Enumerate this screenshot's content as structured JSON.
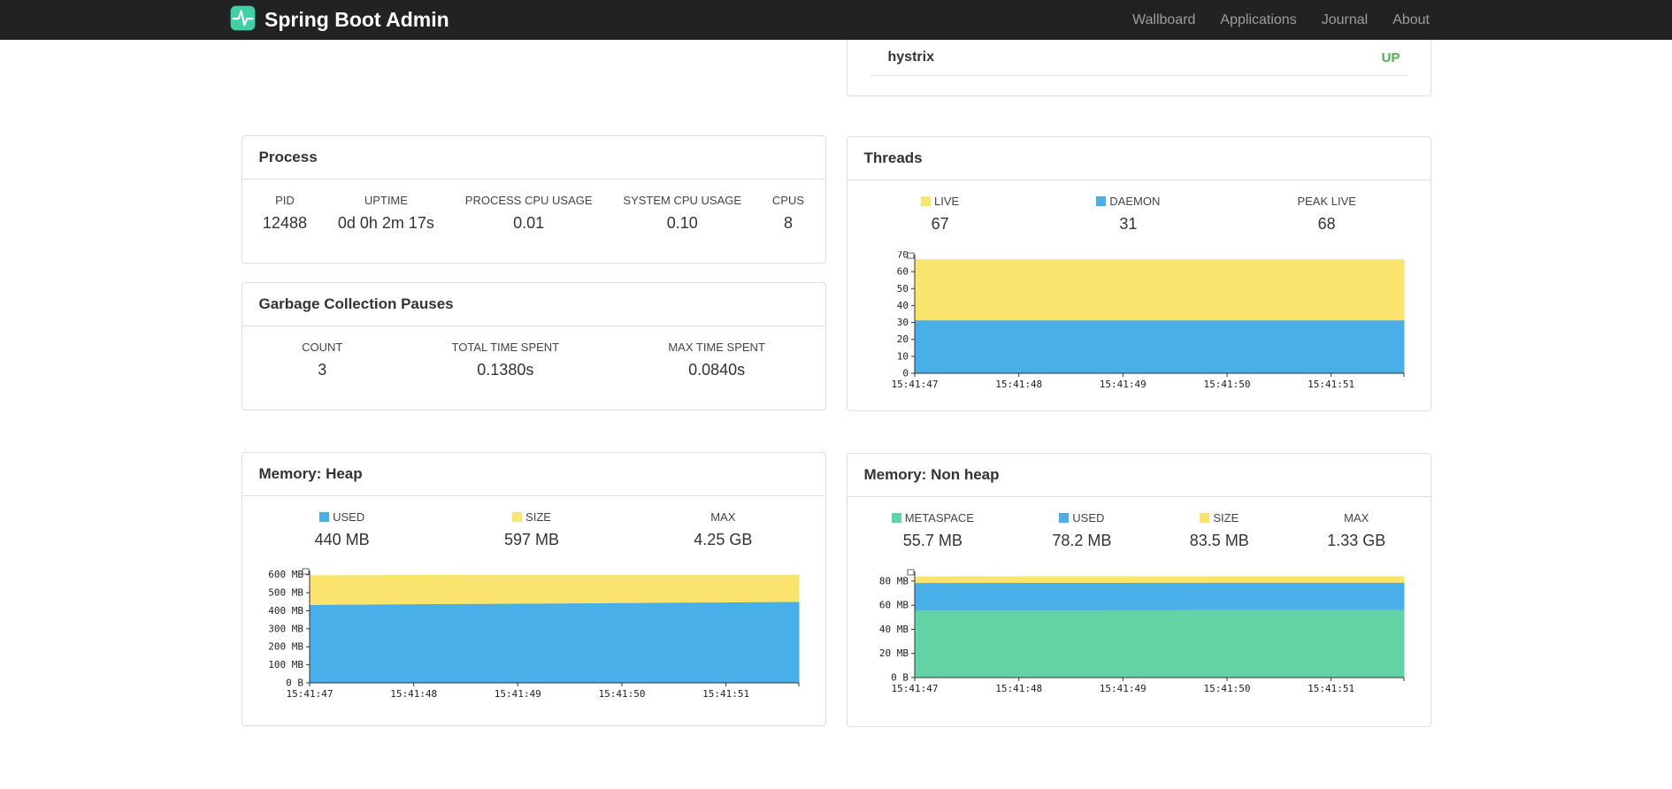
{
  "navbar": {
    "brand": "Spring Boot Admin",
    "items": [
      {
        "label": "Wallboard"
      },
      {
        "label": "Applications"
      },
      {
        "label": "Journal"
      },
      {
        "label": "About"
      }
    ]
  },
  "colors": {
    "accent_teal": "#41D0A5",
    "status_up": "#4CAF50",
    "series_yellow": "#FBE46D",
    "series_blue": "#49AFE8",
    "series_green": "#63D3A6"
  },
  "health": {
    "service": "hystrix",
    "status": "UP"
  },
  "process": {
    "title": "Process",
    "stats": [
      {
        "label": "PID",
        "value": "12488"
      },
      {
        "label": "UPTIME",
        "value": "0d 0h 2m 17s"
      },
      {
        "label": "PROCESS CPU USAGE",
        "value": "0.01"
      },
      {
        "label": "SYSTEM CPU USAGE",
        "value": "0.10"
      },
      {
        "label": "CPUS",
        "value": "8"
      }
    ]
  },
  "gc": {
    "title": "Garbage Collection Pauses",
    "stats": [
      {
        "label": "COUNT",
        "value": "3"
      },
      {
        "label": "TOTAL TIME SPENT",
        "value": "0.1380s"
      },
      {
        "label": "MAX TIME SPENT",
        "value": "0.0840s"
      }
    ]
  },
  "threads": {
    "title": "Threads",
    "stats": [
      {
        "label": "LIVE",
        "value": "67",
        "swatch": "#FBE46D"
      },
      {
        "label": "DAEMON",
        "value": "31",
        "swatch": "#49AFE8"
      },
      {
        "label": "PEAK LIVE",
        "value": "68"
      }
    ]
  },
  "heap": {
    "title": "Memory: Heap",
    "stats": [
      {
        "label": "USED",
        "value": "440 MB",
        "swatch": "#49AFE8"
      },
      {
        "label": "SIZE",
        "value": "597 MB",
        "swatch": "#FBE46D"
      },
      {
        "label": "MAX",
        "value": "4.25 GB"
      }
    ]
  },
  "nonheap": {
    "title": "Memory: Non heap",
    "stats": [
      {
        "label": "METASPACE",
        "value": "55.7 MB",
        "swatch": "#63D3A6"
      },
      {
        "label": "USED",
        "value": "78.2 MB",
        "swatch": "#49AFE8"
      },
      {
        "label": "SIZE",
        "value": "83.5 MB",
        "swatch": "#FBE46D"
      },
      {
        "label": "MAX",
        "value": "1.33 GB"
      }
    ]
  },
  "chart_data": [
    {
      "id": "threads",
      "type": "area",
      "title": "Threads",
      "x_labels": [
        "15:41:47",
        "15:41:48",
        "15:41:49",
        "15:41:50",
        "15:41:51"
      ],
      "y_tick_values": [
        0,
        10,
        20,
        30,
        40,
        50,
        60,
        70
      ],
      "y_tick_labels": [
        "0",
        "10",
        "20",
        "30",
        "40",
        "50",
        "60",
        "70"
      ],
      "y_max": 70,
      "legend_position": "above",
      "grid": false,
      "series": [
        {
          "name": "LIVE",
          "color": "#FBE46D",
          "values": [
            67,
            67,
            67,
            67,
            67,
            67
          ]
        },
        {
          "name": "DAEMON",
          "color": "#49AFE8",
          "values": [
            31,
            31,
            31,
            31,
            31,
            31
          ]
        }
      ]
    },
    {
      "id": "memory-heap",
      "type": "area",
      "title": "Memory: Heap",
      "x_labels": [
        "15:41:47",
        "15:41:48",
        "15:41:49",
        "15:41:50",
        "15:41:51"
      ],
      "y_tick_values": [
        0,
        100,
        200,
        300,
        400,
        500,
        600
      ],
      "y_tick_labels": [
        "0 B",
        "100 MB",
        "200 MB",
        "300 MB",
        "400 MB",
        "500 MB",
        "600 MB"
      ],
      "y_max": 623,
      "y_unit": "MB",
      "legend_position": "above",
      "grid": false,
      "series": [
        {
          "name": "SIZE",
          "color": "#FBE46D",
          "values": [
            594,
            596,
            597,
            597,
            597,
            597
          ]
        },
        {
          "name": "USED",
          "color": "#49AFE8",
          "values": [
            429,
            433,
            436,
            439,
            443,
            446
          ]
        }
      ]
    },
    {
      "id": "memory-nonheap",
      "type": "area",
      "title": "Memory: Non heap",
      "x_labels": [
        "15:41:47",
        "15:41:48",
        "15:41:49",
        "15:41:50",
        "15:41:51"
      ],
      "y_tick_values": [
        0,
        20,
        40,
        60,
        80
      ],
      "y_tick_labels": [
        "0 B",
        "20 MB",
        "40 MB",
        "60 MB",
        "80 MB"
      ],
      "y_max": 88,
      "y_unit": "MB",
      "legend_position": "above",
      "grid": false,
      "series": [
        {
          "name": "SIZE",
          "color": "#FBE46D",
          "values": [
            83.4,
            83.5,
            83.5,
            83.5,
            83.5,
            83.5
          ]
        },
        {
          "name": "USED",
          "color": "#49AFE8",
          "values": [
            78.0,
            78.1,
            78.1,
            78.2,
            78.2,
            78.2
          ]
        },
        {
          "name": "METASPACE",
          "color": "#63D3A6",
          "values": [
            55.5,
            55.6,
            55.6,
            55.7,
            55.7,
            55.7
          ]
        }
      ]
    }
  ]
}
